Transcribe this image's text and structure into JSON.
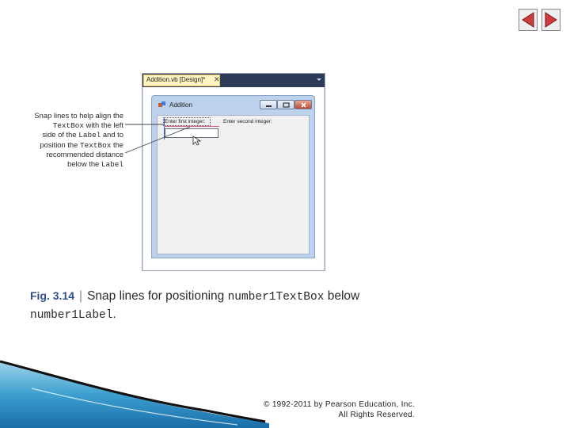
{
  "nav": {
    "prev_icon": "triangle-left-icon",
    "next_icon": "triangle-right-icon",
    "color": "#cf3a3a"
  },
  "ide": {
    "tab_label": "Addition.vb [Design]*",
    "tab_close": "✕"
  },
  "form": {
    "title": "Addition",
    "label1": "Enter first integer:",
    "label2": "Enter second integer:"
  },
  "callout": {
    "line1": "Snap lines to help align the",
    "line2_code": "TextBox",
    "line2_rest": " with the left",
    "line3_pre": "side of the ",
    "line3_code": "Label",
    "line3_post": " and to",
    "line4_pre": "position the ",
    "line4_code": "TextBox",
    "line4_post": " the",
    "line5": "recommended distance",
    "line6_pre": "below the ",
    "line6_code": "Label"
  },
  "caption": {
    "label": "Fig. 3.14",
    "separator": "|",
    "text1": "Snap lines for positioning ",
    "code1": "number1TextBox",
    "text2": " below ",
    "code2": "number1Label",
    "text3": "."
  },
  "copyright": {
    "line1": "© 1992-2011 by Pearson Education, Inc.",
    "line2": "All Rights Reserved."
  }
}
